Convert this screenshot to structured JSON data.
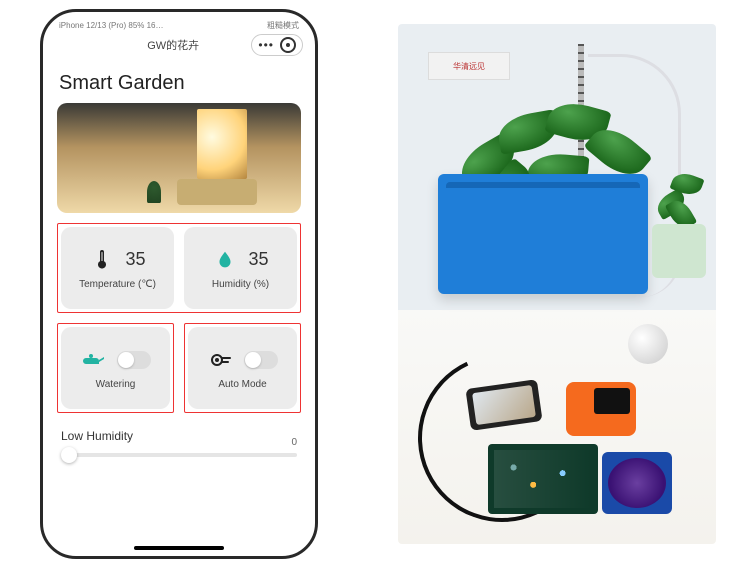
{
  "status_bar": {
    "left": "iPhone 12/13 (Pro) 85% 16…",
    "right": "粗糙模式"
  },
  "mini_program": {
    "title": "GW的花卉"
  },
  "page": {
    "title": "Smart Garden"
  },
  "sensors": {
    "temperature": {
      "value": "35",
      "label": "Temperature",
      "unit": "(℃)"
    },
    "humidity": {
      "value": "35",
      "label": "Humidity",
      "unit": "(%)"
    }
  },
  "controls": {
    "watering": {
      "label": "Watering",
      "state": "off"
    },
    "auto_mode": {
      "label": "Auto Mode",
      "state": "off"
    }
  },
  "slider": {
    "label": "Low Humidity",
    "value": "0"
  },
  "photo": {
    "wall_sign": "华清远见"
  },
  "colors": {
    "accent": "#22b3a2",
    "highlight": "#e33"
  }
}
